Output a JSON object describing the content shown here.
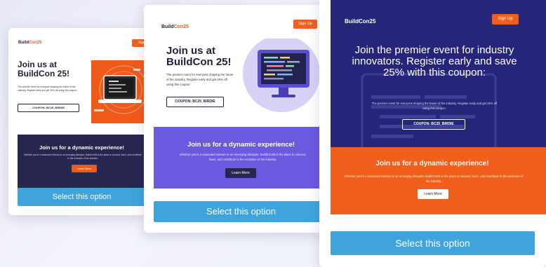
{
  "colors": {
    "brand_orange": "#f05a19",
    "navy": "#1f1f4a",
    "purple": "#6a5ae0",
    "select_blue": "#3fa4dc"
  },
  "cards": [
    {
      "logo_prefix": "Build",
      "logo_suffix": "Con25",
      "signup_label": "Sign",
      "headline": "Join us at BuildCon 25!",
      "body": "The premier event for everyone shaping the future of the industry. Register early and get 25% off using this coupon:",
      "coupon": "COUPON: BC25_BIRDIE",
      "section_title": "Join us for a dynamic experience!",
      "section_body": "Whether you're a seasoned veteran or an emerging disruptor, BuildCon25 is the place to connect, learn, and contribute to the evolution of the industry.",
      "learn_more": "Learn More",
      "select_label": "Select this option"
    },
    {
      "logo_prefix": "Build",
      "logo_suffix": "Con25",
      "signup_label": "Sign Up",
      "headline": "Join us at BuildCon 25!",
      "body": "The premier event for everyone shaping the future of the industry. Register early and get 25% off using this coupon:",
      "coupon": "COUPON: BC25_BIRDIE",
      "section_title": "Join us for a dynamic experience!",
      "section_body": "Whether you're a seasoned veteran or an emerging disruptor, BuildCon25 is the place to connect, learn, and contribute to the evolution of the industry.",
      "learn_more": "Learn More",
      "select_label": "Select this option"
    },
    {
      "logo_prefix": "Build",
      "logo_suffix": "Con25",
      "signup_label": "Sign Up",
      "headline": "Join the premier event for industry innovators. Register early and save 25% with this coupon:",
      "body": "The premier event for everyone shaping the future of the industry. Register early and get 25% off using this coupon:",
      "coupon": "COUPON: BC25_BIRDIE",
      "section_title": "Join us for a dynamic experience!",
      "section_body": "Whether you're a seasoned veteran or an emerging disruptor, BuildCon25 is the place to connect, learn, and contribute to the evolution of the industry.",
      "learn_more": "Learn More",
      "select_label": "Select this option"
    }
  ]
}
